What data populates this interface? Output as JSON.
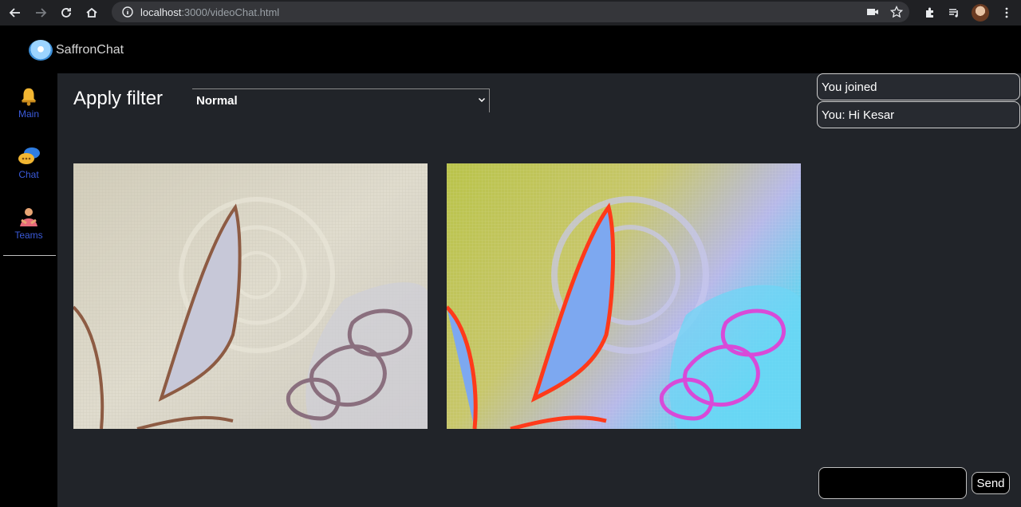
{
  "browser": {
    "url_host": "localhost",
    "url_path": ":3000/videoChat.html"
  },
  "app": {
    "brand_name": "SaffronChat"
  },
  "sidebar": {
    "items": [
      {
        "label": "Main",
        "icon": "bell-icon"
      },
      {
        "label": "Chat",
        "icon": "chat-bubbles-icon"
      },
      {
        "label": "Teams",
        "icon": "teams-icon"
      }
    ]
  },
  "filter": {
    "label": "Apply filter",
    "selected": "Normal"
  },
  "chat": {
    "messages": [
      {
        "text": "You joined"
      },
      {
        "text": "You: Hi Kesar"
      }
    ],
    "input_value": "",
    "send_label": "Send"
  },
  "colors": {
    "main_bg": "#212429",
    "sidebar_label": "#3b5bdb"
  }
}
